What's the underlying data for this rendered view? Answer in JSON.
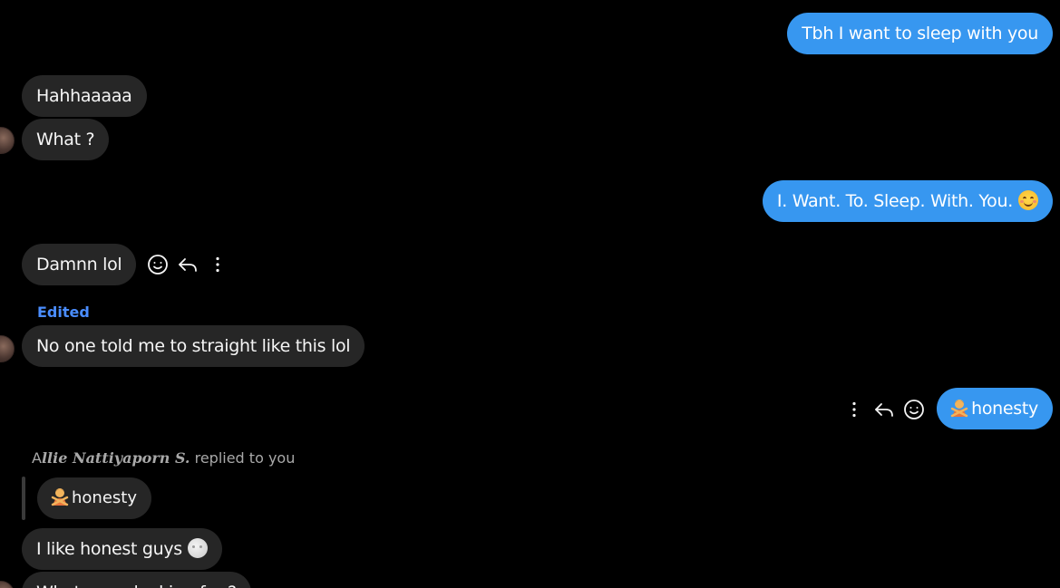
{
  "messages": {
    "m1": {
      "text": "Tbh I want to sleep with you",
      "direction": "outgoing"
    },
    "m2": {
      "text": "Hahhaaaaa",
      "direction": "incoming"
    },
    "m3": {
      "text": "What ?",
      "direction": "incoming"
    },
    "m4": {
      "text": "I. Want. To. Sleep. With. You.",
      "emoji": "smiling-face-with-smiling-eyes",
      "direction": "outgoing"
    },
    "m5": {
      "text": "Damnn lol",
      "direction": "incoming"
    },
    "m6": {
      "edited_label": "Edited",
      "text": "No one told me to straight like this lol",
      "direction": "incoming"
    },
    "m7": {
      "text": "honesty",
      "emoji": "person-gesturing-no",
      "direction": "outgoing"
    },
    "m8": {
      "reply_prefix": "A",
      "reply_name": "llie Nattiyaporn S.",
      "reply_suffix": " replied to you",
      "quoted_text": "honesty",
      "quoted_emoji": "person-gesturing-no",
      "direction": "incoming"
    },
    "m9": {
      "text": "I like honest guys",
      "emoji": "full-moon-face",
      "direction": "incoming"
    },
    "m10": {
      "text": "What are u looking for ?",
      "direction": "incoming"
    }
  },
  "icons": {
    "react": "smiley-face-icon",
    "reply": "reply-arrow-icon",
    "more": "more-options-icon"
  },
  "colors": {
    "background": "#000000",
    "incoming_bubble": "#262626",
    "outgoing_bubble": "#3797f0",
    "edited": "#4a8dff",
    "meta_text": "#a8a8a8"
  }
}
